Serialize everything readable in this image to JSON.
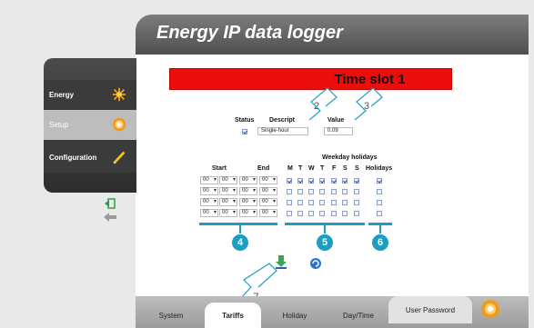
{
  "app": {
    "title": "Energy IP data logger"
  },
  "sidebar": {
    "items": [
      {
        "label": "Energy",
        "icon": "energy-sparkle-icon"
      },
      {
        "label": "Setup",
        "icon": "setup-gear-icon"
      },
      {
        "label": "Configuration",
        "icon": "pencil-icon"
      }
    ]
  },
  "slot": {
    "title": "Time slot 1"
  },
  "status_table": {
    "headers": {
      "status": "Status",
      "description": "Descript",
      "value": "Value"
    },
    "description_value": "Single-hour",
    "value": "0.09"
  },
  "schedule": {
    "weekday_holidays_label": "Weekday holidays",
    "start_label": "Start",
    "end_label": "End",
    "days": [
      "M",
      "T",
      "W",
      "T",
      "F",
      "S",
      "S"
    ],
    "holidays_label": "Holidays",
    "time_value": "00"
  },
  "callouts": [
    "2",
    "3",
    "4",
    "5",
    "6",
    "7"
  ],
  "tabs": [
    "System",
    "Tariffs",
    "Holiday",
    "Day/Time",
    "User Password"
  ],
  "colors": {
    "accent": "#1d9ec0",
    "slot_red": "#ee0d0d"
  }
}
